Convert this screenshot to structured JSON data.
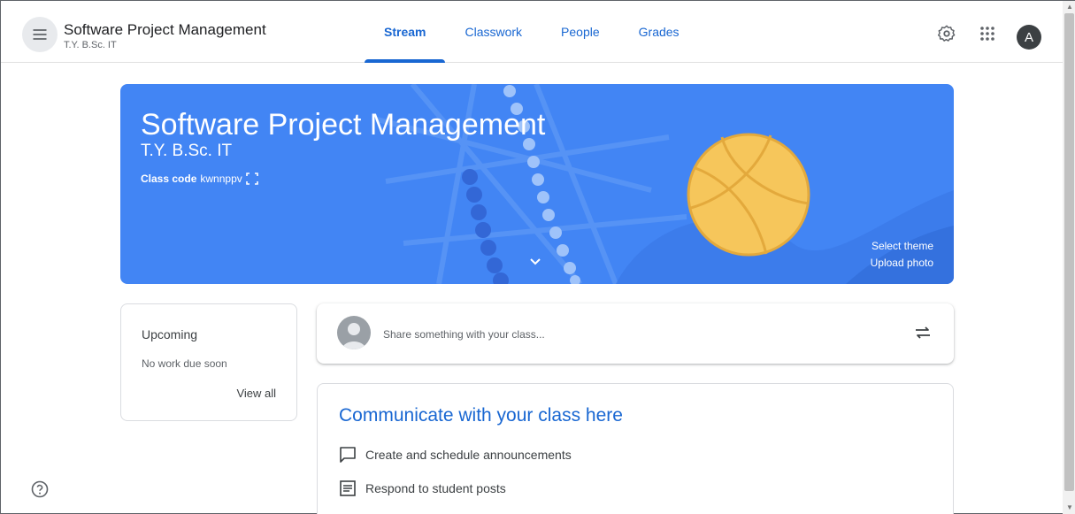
{
  "header": {
    "class_title": "Software Project Management",
    "class_subtitle": "T.Y. B.Sc. IT",
    "tabs": [
      {
        "label": "Stream"
      },
      {
        "label": "Classwork"
      },
      {
        "label": "People"
      },
      {
        "label": "Grades"
      }
    ],
    "active_tab": "Stream",
    "avatar_letter": "A",
    "icons": [
      "menu-icon",
      "settings-icon",
      "apps-grid-icon"
    ]
  },
  "banner": {
    "title": "Software Project Management",
    "subtitle": "T.Y. B.Sc. IT",
    "class_code_label": "Class code",
    "class_code": "kwnnppv",
    "select_theme": "Select theme",
    "upload_photo": "Upload photo",
    "color": "#4285f4"
  },
  "upcoming": {
    "title": "Upcoming",
    "empty_text": "No work due soon",
    "view_all": "View all"
  },
  "share": {
    "placeholder": "Share something with your class..."
  },
  "communicate": {
    "title": "Communicate with your class here",
    "items": [
      {
        "label": "Create and schedule announcements",
        "icon": "announcement-icon"
      },
      {
        "label": "Respond to student posts",
        "icon": "post-icon"
      }
    ]
  },
  "colors": {
    "accent": "#1967d2",
    "banner": "#4285f4",
    "text": "#3c4043"
  }
}
